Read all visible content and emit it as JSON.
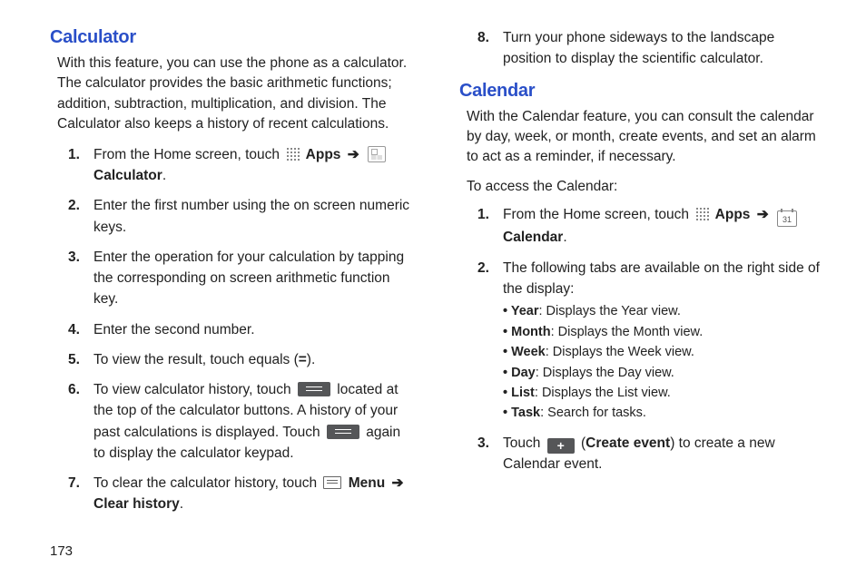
{
  "page_number": "173",
  "left": {
    "heading_calculator": "Calculator",
    "calc_intro": "With this feature, you can use the phone as a calculator. The calculator provides the basic arithmetic functions; addition, subtraction, multiplication, and division. The Calculator also keeps a history of recent calculations.",
    "steps": {
      "n1": "1.",
      "s1a": "From the Home screen, touch ",
      "s1_apps": "Apps",
      "s1_arrow": " ➔ ",
      "s1b": "Calculator",
      "s1c": ".",
      "n2": "2.",
      "s2": "Enter the first number using the on screen numeric keys.",
      "n3": "3.",
      "s3": "Enter the operation for your calculation by tapping the corresponding on screen arithmetic function key.",
      "n4": "4.",
      "s4": "Enter the second number.",
      "n5": "5.",
      "s5a": "To view the result, touch equals (",
      "s5b": "=",
      "s5c": ").",
      "n6": "6.",
      "s6a": "To view calculator history, touch ",
      "s6b": " located at the top of the calculator buttons. A history of your past calculations is displayed. Touch ",
      "s6c": " again to display the calculator keypad.",
      "n7": "7.",
      "s7a": "To clear the calculator history, touch ",
      "s7_menu": "Menu",
      "s7_arrow": " ➔ ",
      "s7_clear": "Clear history",
      "s7b": "."
    }
  },
  "right": {
    "step8_n": "8.",
    "step8": "Turn your phone sideways to the landscape position to display the scientific calculator.",
    "heading_calendar": "Calendar",
    "cal_intro": "With the Calendar feature, you can consult the calendar by day, week, or month, create events, and set an alarm to act as a reminder, if necessary.",
    "cal_access": "To access the Calendar:",
    "cal_icon_text": "31",
    "steps": {
      "n1": "1.",
      "s1a": "From the Home screen, touch ",
      "s1_apps": "Apps",
      "s1_arrow": " ➔ ",
      "s1b": "Calendar",
      "s1c": ".",
      "n2": "2.",
      "s2": "The following tabs are available on the right side of the display:",
      "tabs": {
        "year_b": "Year",
        "year": ": Displays the Year view.",
        "month_b": "Month",
        "month": ": Displays the Month view.",
        "week_b": "Week",
        "week": ": Displays the Week view.",
        "day_b": "Day",
        "day": ": Displays the Day view.",
        "list_b": "List",
        "list": ": Displays the List view.",
        "task_b": "Task",
        "task": ": Search for tasks."
      },
      "n3": "3.",
      "s3a": "Touch ",
      "s3_plus": "+",
      "s3b": " (",
      "s3_create": "Create event",
      "s3c": ") to create a new Calendar event."
    }
  }
}
